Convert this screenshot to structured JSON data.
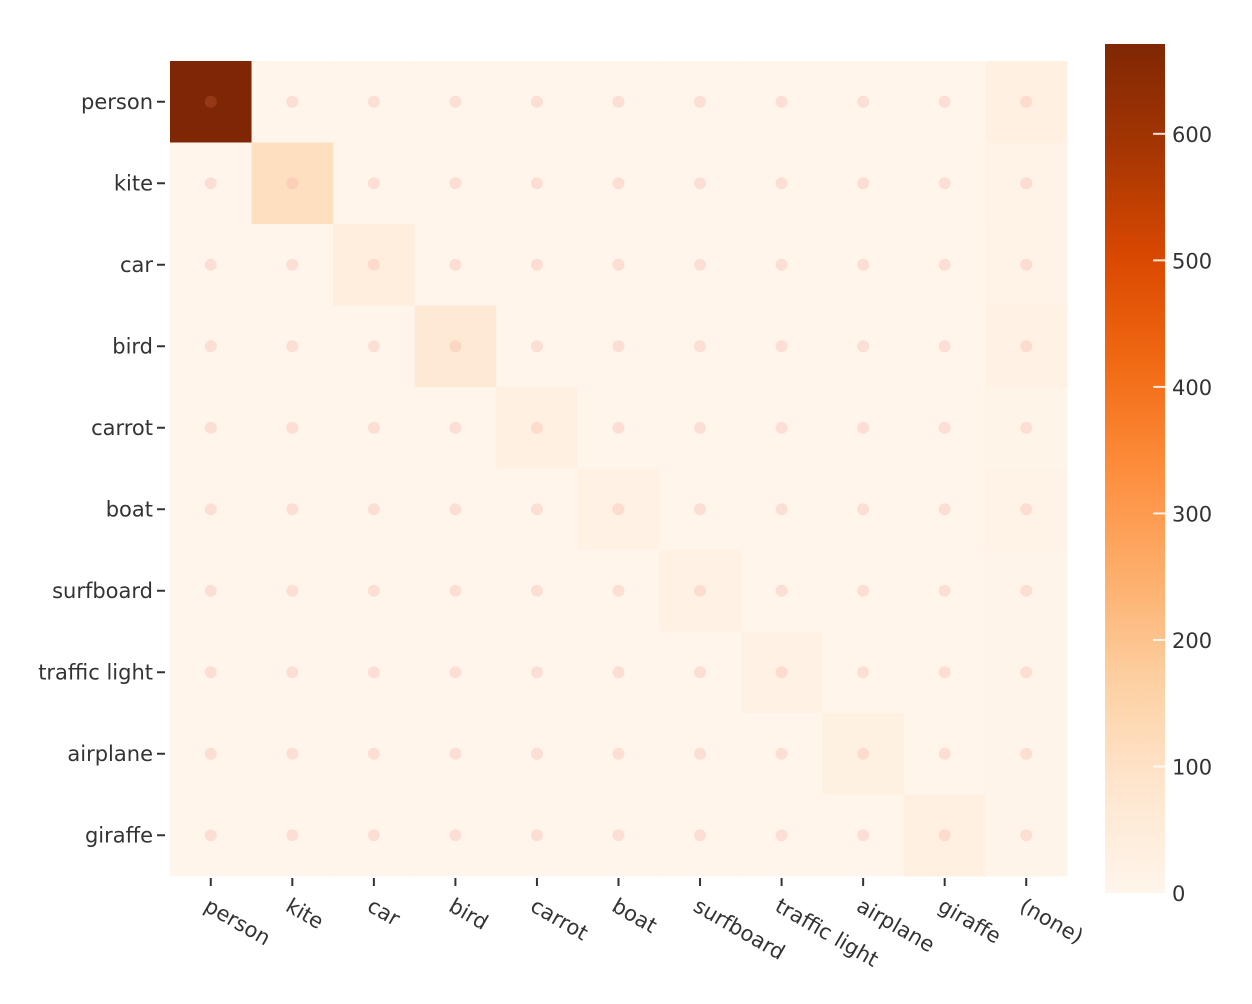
{
  "chart_data": {
    "type": "heatmap",
    "title": "",
    "xlabel": "",
    "ylabel": "",
    "x_categories": [
      "person",
      "kite",
      "car",
      "bird",
      "carrot",
      "boat",
      "surfboard",
      "traffic light",
      "airplane",
      "giraffe",
      "(none)"
    ],
    "y_categories": [
      "person",
      "kite",
      "car",
      "bird",
      "carrot",
      "boat",
      "surfboard",
      "traffic light",
      "airplane",
      "giraffe"
    ],
    "values": [
      [
        671,
        0,
        0,
        0,
        0,
        0,
        0,
        0,
        0,
        0,
        30
      ],
      [
        0,
        110,
        0,
        0,
        0,
        0,
        0,
        0,
        0,
        0,
        15
      ],
      [
        0,
        0,
        40,
        0,
        0,
        0,
        0,
        0,
        0,
        0,
        10
      ],
      [
        0,
        0,
        0,
        65,
        0,
        0,
        0,
        0,
        0,
        0,
        18
      ],
      [
        0,
        0,
        0,
        0,
        30,
        0,
        0,
        0,
        0,
        0,
        8
      ],
      [
        0,
        0,
        0,
        0,
        0,
        22,
        0,
        0,
        0,
        0,
        15
      ],
      [
        0,
        0,
        0,
        0,
        0,
        0,
        18,
        0,
        0,
        0,
        6
      ],
      [
        0,
        0,
        0,
        0,
        0,
        0,
        0,
        20,
        0,
        0,
        5
      ],
      [
        0,
        0,
        0,
        0,
        0,
        0,
        0,
        0,
        25,
        0,
        7
      ],
      [
        0,
        0,
        0,
        0,
        0,
        0,
        0,
        0,
        0,
        28,
        4
      ]
    ],
    "colorscale": "Oranges",
    "colorscale_stops": [
      "#fff5eb",
      "#fee6ce",
      "#fdd0a2",
      "#fdae6b",
      "#fd8d3c",
      "#f16913",
      "#d94801",
      "#a63603",
      "#7f2704"
    ],
    "zrange": [
      0,
      671
    ],
    "colorbar": {
      "ticks": [
        0,
        100,
        200,
        300,
        400,
        500,
        600
      ],
      "tick_labels": [
        "0",
        "100",
        "200",
        "300",
        "400",
        "500",
        "600"
      ],
      "placement": "right"
    },
    "markers": {
      "shown": true,
      "color": "#fcd5cc",
      "description": "faint dot at every cell center"
    },
    "grid": false,
    "x_tick_label_rotation": "30deg clockwise"
  }
}
